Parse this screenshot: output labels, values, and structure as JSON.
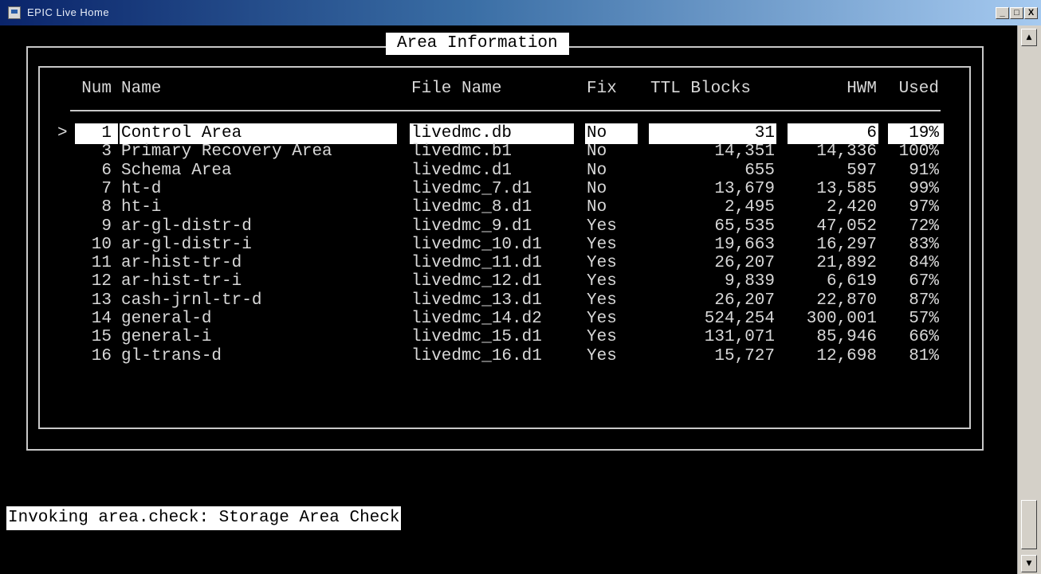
{
  "window": {
    "title": "EPIC Live Home"
  },
  "window_buttons": {
    "minimize": "_",
    "maximize": "□",
    "close": "X"
  },
  "scrollbar": {
    "up": "▲",
    "down": "▼"
  },
  "panel": {
    "title": "Area Information"
  },
  "headers": {
    "num": "Num",
    "name": "Name",
    "file": "File Name",
    "fix": "Fix",
    "ttl": "TTL Blocks",
    "hwm": "HWM",
    "used": "Used"
  },
  "cursor": ">",
  "rows": [
    {
      "num": "1",
      "name": "Control Area",
      "file": "livedmc.db",
      "fix": "No",
      "ttl": "31",
      "hwm": "6",
      "used": "19%",
      "selected": true
    },
    {
      "num": "3",
      "name": "Primary Recovery Area",
      "file": "livedmc.b1",
      "fix": "No",
      "ttl": "14,351",
      "hwm": "14,336",
      "used": "100%"
    },
    {
      "num": "6",
      "name": "Schema Area",
      "file": "livedmc.d1",
      "fix": "No",
      "ttl": "655",
      "hwm": "597",
      "used": "91%"
    },
    {
      "num": "7",
      "name": "ht-d",
      "file": "livedmc_7.d1",
      "fix": "No",
      "ttl": "13,679",
      "hwm": "13,585",
      "used": "99%"
    },
    {
      "num": "8",
      "name": "ht-i",
      "file": "livedmc_8.d1",
      "fix": "No",
      "ttl": "2,495",
      "hwm": "2,420",
      "used": "97%"
    },
    {
      "num": "9",
      "name": "ar-gl-distr-d",
      "file": "livedmc_9.d1",
      "fix": "Yes",
      "ttl": "65,535",
      "hwm": "47,052",
      "used": "72%"
    },
    {
      "num": "10",
      "name": "ar-gl-distr-i",
      "file": "livedmc_10.d1",
      "fix": "Yes",
      "ttl": "19,663",
      "hwm": "16,297",
      "used": "83%"
    },
    {
      "num": "11",
      "name": "ar-hist-tr-d",
      "file": "livedmc_11.d1",
      "fix": "Yes",
      "ttl": "26,207",
      "hwm": "21,892",
      "used": "84%"
    },
    {
      "num": "12",
      "name": "ar-hist-tr-i",
      "file": "livedmc_12.d1",
      "fix": "Yes",
      "ttl": "9,839",
      "hwm": "6,619",
      "used": "67%"
    },
    {
      "num": "13",
      "name": "cash-jrnl-tr-d",
      "file": "livedmc_13.d1",
      "fix": "Yes",
      "ttl": "26,207",
      "hwm": "22,870",
      "used": "87%"
    },
    {
      "num": "14",
      "name": "general-d",
      "file": "livedmc_14.d2",
      "fix": "Yes",
      "ttl": "524,254",
      "hwm": "300,001",
      "used": "57%"
    },
    {
      "num": "15",
      "name": "general-i",
      "file": "livedmc_15.d1",
      "fix": "Yes",
      "ttl": "131,071",
      "hwm": "85,946",
      "used": "66%"
    },
    {
      "num": "16",
      "name": "gl-trans-d",
      "file": "livedmc_16.d1",
      "fix": "Yes",
      "ttl": "15,727",
      "hwm": "12,698",
      "used": "81%"
    }
  ],
  "status": {
    "text": "Invoking area.check: Storage Area Check"
  }
}
